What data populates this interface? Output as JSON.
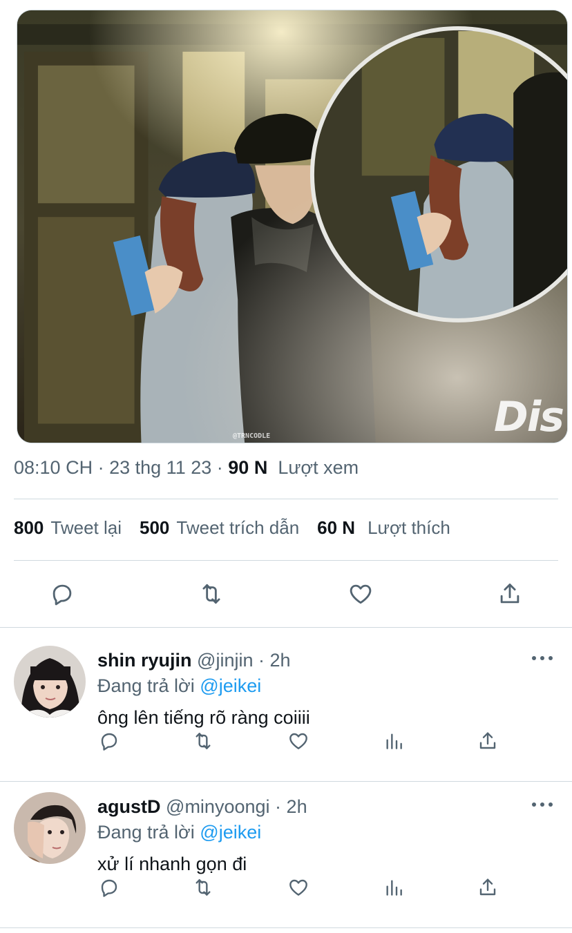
{
  "tweet": {
    "media": {
      "watermark": "Dis",
      "credit": "@TRNCODLE"
    },
    "meta": {
      "time": "08:10 CH",
      "separator": "·",
      "date": "23 thg 11 23",
      "views_count": "90 N",
      "views_label": "Lượt xem"
    },
    "stats": {
      "retweets_count": "800",
      "retweets_label": "Tweet lại",
      "quotes_count": "500",
      "quotes_label": "Tweet trích dẫn",
      "likes_count": "60 N",
      "likes_label": "Lượt thích"
    },
    "actions": [
      "reply-icon",
      "retweet-icon",
      "heart-icon",
      "share-icon"
    ]
  },
  "replies": [
    {
      "name": "shin ryujin",
      "handle": "@jinjin",
      "dot": "·",
      "time": "2h",
      "replying_prefix": "Đang trả lời",
      "replying_to": "@jeikei",
      "text": "ông lên tiếng rõ ràng coiiii"
    },
    {
      "name": "agustD",
      "handle": "@minyoongi",
      "dot": "·",
      "time": "2h",
      "replying_prefix": "Đang trả lời",
      "replying_to": "@jeikei",
      "text": "xử lí nhanh gọn đi"
    }
  ],
  "colors": {
    "text_primary": "#0f1419",
    "text_secondary": "#536471",
    "link": "#1d9bf0",
    "divider": "#cfd9de"
  }
}
